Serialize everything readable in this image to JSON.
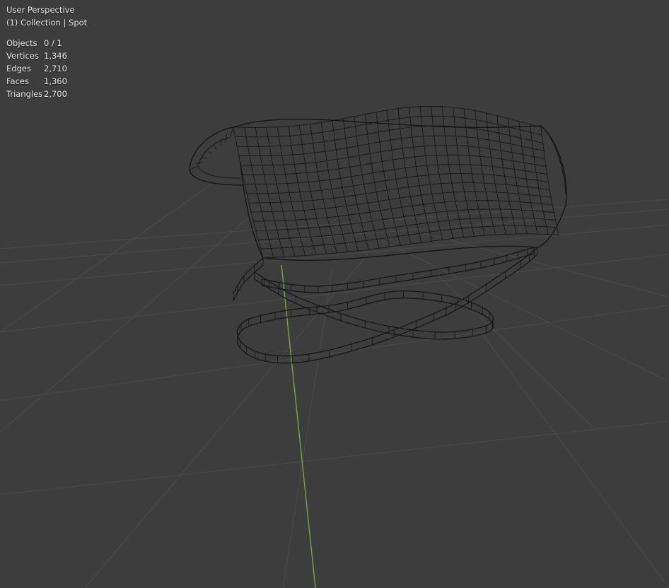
{
  "viewport": {
    "view_name": "User Perspective",
    "collection_line": "(1) Collection | Spot",
    "colors": {
      "background": "#3d3d3d",
      "grid": "#4a4a4a",
      "y_axis": "#7ea33a",
      "wire": "#141414"
    }
  },
  "stats": [
    {
      "label": "Objects",
      "value": "0 / 1"
    },
    {
      "label": "Vertices",
      "value": "1,346"
    },
    {
      "label": "Edges",
      "value": "2,710"
    },
    {
      "label": "Faces",
      "value": "1,360"
    },
    {
      "label": "Triangles",
      "value": "2,700"
    }
  ]
}
